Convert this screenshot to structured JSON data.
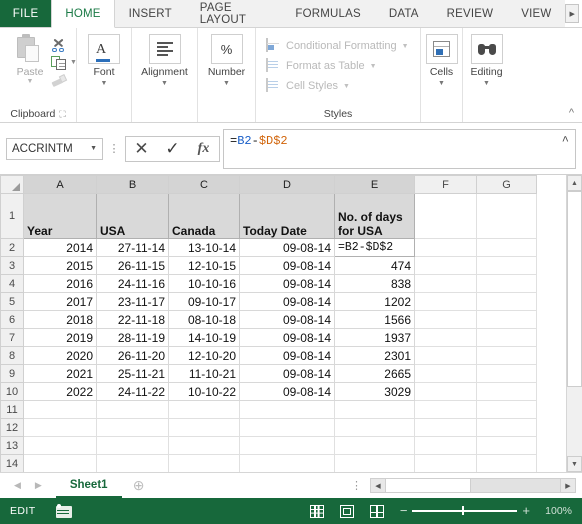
{
  "ribbon": {
    "file_tab": "FILE",
    "tabs": [
      {
        "label": "HOME",
        "active": true
      },
      {
        "label": "INSERT",
        "active": false
      },
      {
        "label": "PAGE LAYOUT",
        "active": false
      },
      {
        "label": "FORMULAS",
        "active": false
      },
      {
        "label": "DATA",
        "active": false
      },
      {
        "label": "REVIEW",
        "active": false
      },
      {
        "label": "VIEW",
        "active": false
      }
    ],
    "groups": {
      "clipboard": {
        "label": "Clipboard",
        "paste_label": "Paste",
        "cut_icon": "scissors-icon",
        "copy_icon": "copy-icon",
        "format_painter_icon": "format-painter-icon"
      },
      "font": {
        "label": "Font"
      },
      "alignment": {
        "label": "Alignment"
      },
      "number": {
        "label": "Number"
      },
      "styles": {
        "label": "Styles",
        "conditional_formatting": "Conditional Formatting",
        "format_as_table": "Format as Table",
        "cell_styles": "Cell Styles"
      },
      "cells": {
        "label": "Cells"
      },
      "editing": {
        "label": "Editing"
      }
    }
  },
  "formula_bar": {
    "name_box": "ACCRINTM",
    "cancel_icon": "cancel-x-icon",
    "accept_icon": "accept-check-icon",
    "function_icon": "insert-function-icon",
    "formula": "=B2-$D$2",
    "formula_parts": [
      {
        "text": "=",
        "color": "#111111"
      },
      {
        "text": "B2",
        "color": "#1a5fc8"
      },
      {
        "text": "-",
        "color": "#111111"
      },
      {
        "text": "$D$2",
        "color": "#d1640a"
      }
    ]
  },
  "grid": {
    "columns": [
      {
        "label": "A",
        "selected": true,
        "width": 73
      },
      {
        "label": "B",
        "selected": true,
        "width": 72
      },
      {
        "label": "C",
        "selected": true,
        "width": 71
      },
      {
        "label": "D",
        "selected": true,
        "width": 95
      },
      {
        "label": "E",
        "selected": true,
        "width": 80
      },
      {
        "label": "F",
        "selected": false,
        "width": 62
      },
      {
        "label": "G",
        "selected": false,
        "width": 60
      }
    ],
    "header_row_number": "1",
    "headers": [
      "Year",
      "USA",
      "Canada",
      "Today Date",
      "No. of days for USA"
    ],
    "rows": [
      {
        "num": "2",
        "cells": [
          "2014",
          "27-11-14",
          "13-10-14",
          "09-08-14",
          "=B2-$D$2"
        ],
        "editing": true
      },
      {
        "num": "3",
        "cells": [
          "2015",
          "26-11-15",
          "12-10-15",
          "09-08-14",
          "474"
        ],
        "editing": false
      },
      {
        "num": "4",
        "cells": [
          "2016",
          "24-11-16",
          "10-10-16",
          "09-08-14",
          "838"
        ],
        "editing": false
      },
      {
        "num": "5",
        "cells": [
          "2017",
          "23-11-17",
          "09-10-17",
          "09-08-14",
          "1202"
        ],
        "editing": false
      },
      {
        "num": "6",
        "cells": [
          "2018",
          "22-11-18",
          "08-10-18",
          "09-08-14",
          "1566"
        ],
        "editing": false
      },
      {
        "num": "7",
        "cells": [
          "2019",
          "28-11-19",
          "14-10-19",
          "09-08-14",
          "1937"
        ],
        "editing": false
      },
      {
        "num": "8",
        "cells": [
          "2020",
          "26-11-20",
          "12-10-20",
          "09-08-14",
          "2301"
        ],
        "editing": false
      },
      {
        "num": "9",
        "cells": [
          "2021",
          "25-11-21",
          "11-10-21",
          "09-08-14",
          "2665"
        ],
        "editing": false
      },
      {
        "num": "10",
        "cells": [
          "2022",
          "24-11-22",
          "10-10-22",
          "09-08-14",
          "3029"
        ],
        "editing": false
      }
    ],
    "empty_rows": [
      "11",
      "12",
      "13",
      "14"
    ]
  },
  "sheet_bar": {
    "prev_icon": "nav-prev-icon",
    "next_icon": "nav-next-icon",
    "tabs": [
      {
        "label": "Sheet1",
        "active": true
      }
    ],
    "add_sheet_icon": "add-sheet-icon"
  },
  "status_bar": {
    "mode": "EDIT",
    "macro_icon": "record-macro-icon",
    "views": [
      "normal-view-icon",
      "page-layout-view-icon",
      "page-break-preview-icon"
    ],
    "zoom_out": "−",
    "zoom_in": "+",
    "zoom_level": "100%"
  },
  "colors": {
    "brand_green": "#17683b",
    "ref_blue": "#1a5fc8",
    "ref_orange": "#d1640a",
    "header_fill": "#d9d9d9"
  }
}
